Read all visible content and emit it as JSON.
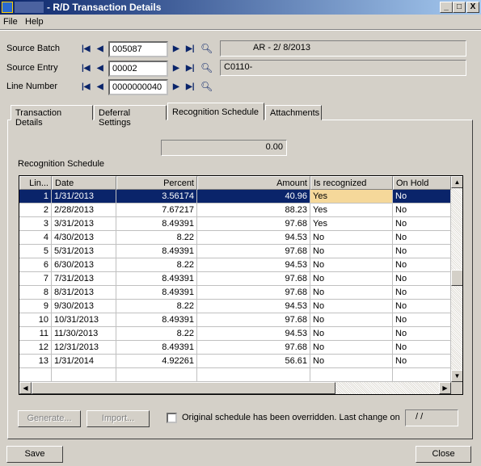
{
  "window": {
    "title": "- R/D Transaction Details",
    "minimize": "_",
    "maximize": "□",
    "close": "X"
  },
  "menu": [
    "File",
    "Help"
  ],
  "fields": [
    {
      "label": "Source Batch",
      "value": "005087",
      "info": "AR - 2/ 8/2013"
    },
    {
      "label": "Source Entry",
      "value": "00002",
      "info": "C0110-"
    },
    {
      "label": "Line Number",
      "value": "0000000040",
      "info": null
    }
  ],
  "tabs": [
    {
      "label": "Transaction Details"
    },
    {
      "label": "Deferral Settings"
    },
    {
      "label": "Recognition Schedule",
      "active": true
    },
    {
      "label": "Attachments"
    }
  ],
  "schedule": {
    "total": "0.00",
    "label": "Recognition Schedule",
    "columns": [
      "Lin...",
      "Date",
      "Percent",
      "Amount",
      "Is recognized",
      "On Hold"
    ],
    "rows": [
      [
        "1",
        "1/31/2013",
        "3.56174",
        "40.96",
        "Yes",
        "No"
      ],
      [
        "2",
        "2/28/2013",
        "7.67217",
        "88.23",
        "Yes",
        "No"
      ],
      [
        "3",
        "3/31/2013",
        "8.49391",
        "97.68",
        "Yes",
        "No"
      ],
      [
        "4",
        "4/30/2013",
        "8.22",
        "94.53",
        "No",
        "No"
      ],
      [
        "5",
        "5/31/2013",
        "8.49391",
        "97.68",
        "No",
        "No"
      ],
      [
        "6",
        "6/30/2013",
        "8.22",
        "94.53",
        "No",
        "No"
      ],
      [
        "7",
        "7/31/2013",
        "8.49391",
        "97.68",
        "No",
        "No"
      ],
      [
        "8",
        "8/31/2013",
        "8.49391",
        "97.68",
        "No",
        "No"
      ],
      [
        "9",
        "9/30/2013",
        "8.22",
        "94.53",
        "No",
        "No"
      ],
      [
        "10",
        "10/31/2013",
        "8.49391",
        "97.68",
        "No",
        "No"
      ],
      [
        "11",
        "11/30/2013",
        "8.22",
        "94.53",
        "No",
        "No"
      ],
      [
        "12",
        "12/31/2013",
        "8.49391",
        "97.68",
        "No",
        "No"
      ],
      [
        "13",
        "1/31/2014",
        "4.92261",
        "56.61",
        "No",
        "No"
      ]
    ],
    "selected_row": 0,
    "highlight_color": "#f5d89a",
    "selection_color": "#0a246a"
  },
  "buttons": {
    "generate": "Generate...",
    "import": "Import...",
    "save": "Save",
    "close": "Close"
  },
  "override": {
    "label": "Original schedule has been overridden. Last change on",
    "checked": false,
    "date": "/   /"
  }
}
